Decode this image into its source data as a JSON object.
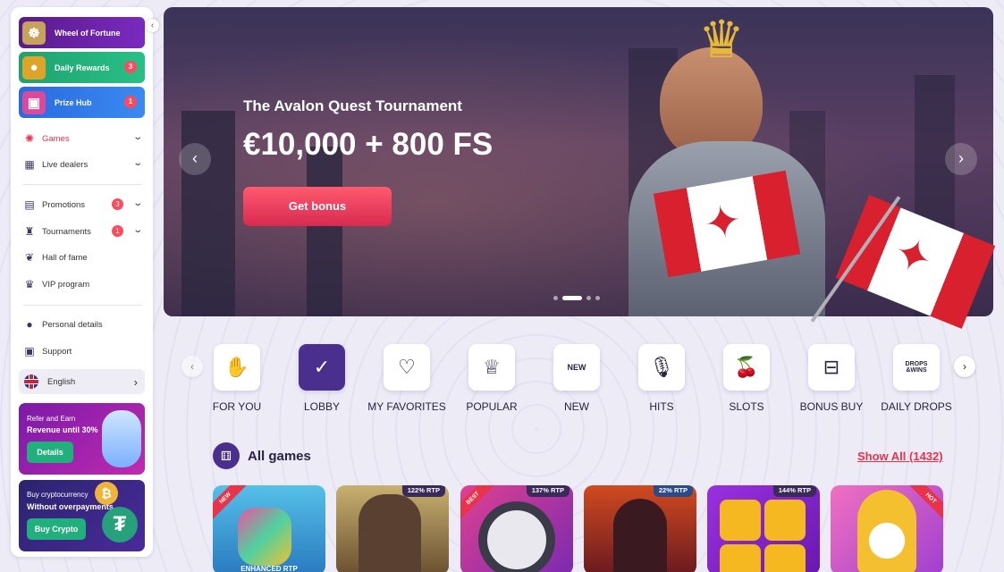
{
  "sidebar": {
    "promos": [
      {
        "label": "Wheel of Fortune",
        "icon": "wheel-icon",
        "badge": ""
      },
      {
        "label": "Daily Rewards",
        "icon": "coins-icon",
        "badge": "3"
      },
      {
        "label": "Prize Hub",
        "icon": "gift-box-icon",
        "badge": "1"
      }
    ],
    "menu": [
      {
        "label": "Games",
        "icon": "games-icon",
        "badge": "",
        "expandable": true,
        "active": true
      },
      {
        "label": "Live dealers",
        "icon": "live-dealers-icon",
        "badge": "",
        "expandable": true
      },
      {
        "label": "Promotions",
        "icon": "gift-icon",
        "badge": "3",
        "expandable": true
      },
      {
        "label": "Tournaments",
        "icon": "trophy-icon",
        "badge": "1",
        "expandable": true
      },
      {
        "label": "Hall of fame",
        "icon": "laurel-icon",
        "badge": ""
      },
      {
        "label": "VIP program",
        "icon": "crown-icon",
        "badge": ""
      },
      {
        "label": "Personal details",
        "icon": "user-icon",
        "badge": ""
      },
      {
        "label": "Support",
        "icon": "support-chat-icon",
        "badge": ""
      }
    ],
    "language": "English",
    "refer_card": {
      "line1": "Refer and Earn",
      "line2": "Revenue until 30%",
      "button": "Details"
    },
    "crypto_card": {
      "line1": "Buy cryptocurrency",
      "line2": "Without overpayments",
      "button": "Buy Crypto"
    }
  },
  "banner": {
    "title": "The Avalon Quest Tournament",
    "prize": "€10,000 + 800 FS",
    "button": "Get bonus",
    "slides": 4,
    "active_slide": 1
  },
  "categories": [
    {
      "label": "FOR YOU",
      "icon": "sparkle-hand-icon"
    },
    {
      "label": "LOBBY",
      "icon": "shield-check-icon",
      "active": true
    },
    {
      "label": "MY FAVORITES",
      "icon": "heart-icon"
    },
    {
      "label": "POPULAR",
      "icon": "crown-icon"
    },
    {
      "label": "NEW",
      "icon": "new-badge-icon"
    },
    {
      "label": "HITS",
      "icon": "microphone-icon"
    },
    {
      "label": "SLOTS",
      "icon": "cherries-icon"
    },
    {
      "label": "BONUS BUY",
      "icon": "treasure-chest-icon"
    },
    {
      "label": "DAILY DROPS",
      "icon": "drops-wins-icon"
    }
  ],
  "games_section": {
    "title": "All games",
    "show_all": "Show All (1432)"
  },
  "games": [
    {
      "name": "game-1",
      "ribbon": "NEW",
      "rtp": "",
      "caption": "ENHANCED RTP",
      "color": "#3fa8d8"
    },
    {
      "name": "game-2",
      "ribbon": "",
      "rtp": "122% RTP",
      "caption": "",
      "color": "#8a7a4a"
    },
    {
      "name": "game-3",
      "ribbon": "BEST",
      "rtp": "137% RTP",
      "caption": "",
      "color": "#d13c7c"
    },
    {
      "name": "game-4",
      "ribbon": "",
      "rtp": "22% RTP",
      "caption": "",
      "color": "#b8452a"
    },
    {
      "name": "game-5",
      "ribbon": "",
      "rtp": "144% RTP",
      "caption": "",
      "color": "#8a2ad8"
    },
    {
      "name": "game-6",
      "ribbon": "HOT",
      "rtp": "",
      "caption": "",
      "color": "#e061b8"
    }
  ]
}
